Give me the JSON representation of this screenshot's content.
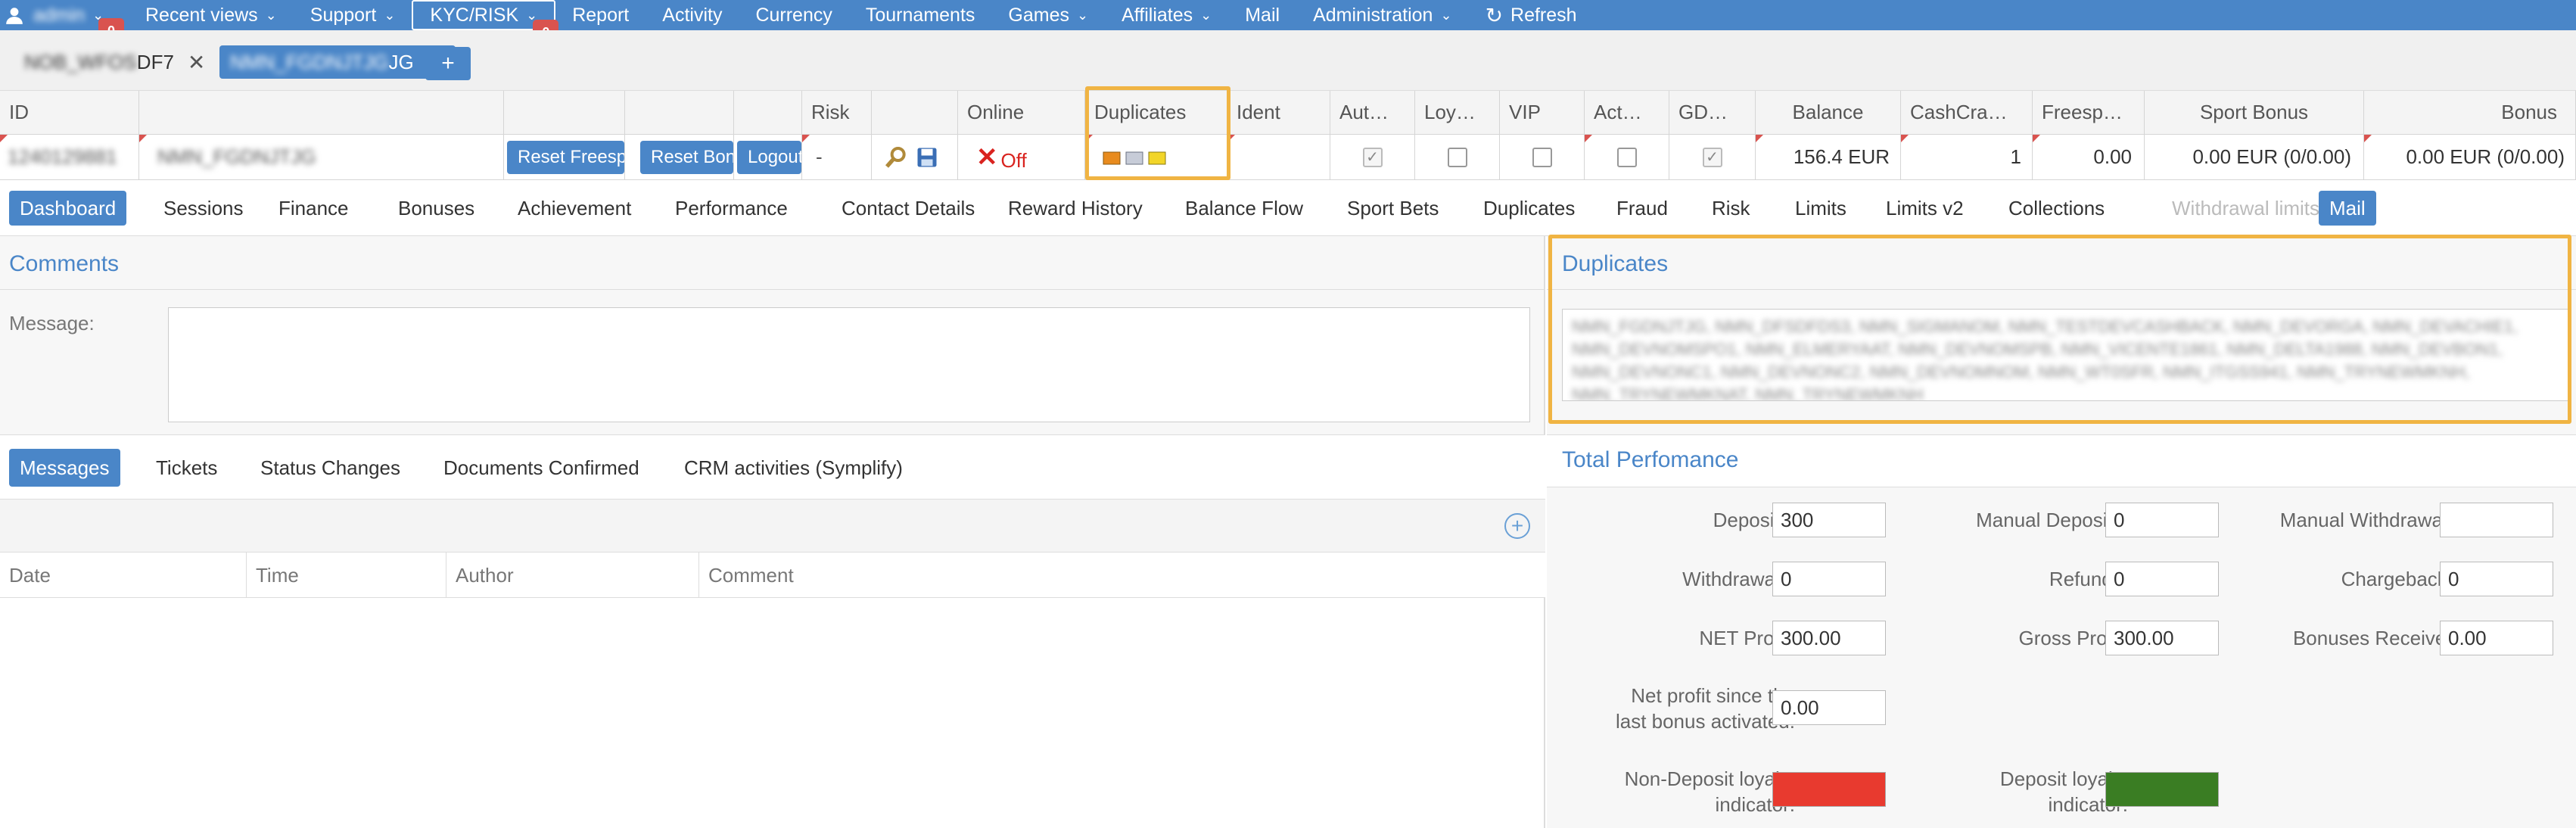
{
  "topnav": {
    "user": "admin",
    "user_badge": "0",
    "items": [
      {
        "label": "Recent views",
        "dropdown": true
      },
      {
        "label": "Support",
        "dropdown": true
      },
      {
        "label": "KYC/RISK",
        "dropdown": true,
        "badge": "0"
      },
      {
        "label": "Report",
        "dropdown": false
      },
      {
        "label": "Activity",
        "dropdown": false
      },
      {
        "label": "Currency",
        "dropdown": false
      },
      {
        "label": "Tournaments",
        "dropdown": false
      },
      {
        "label": "Games",
        "dropdown": true
      },
      {
        "label": "Affiliates",
        "dropdown": true
      },
      {
        "label": "Mail",
        "dropdown": false
      },
      {
        "label": "Administration",
        "dropdown": true
      }
    ],
    "refresh_label": "Refresh"
  },
  "player_tabs": [
    {
      "label_hidden": "NOB_WFOS",
      "label_visible": "DF7"
    },
    {
      "label_hidden": "NMN_FGDNJTJG",
      "label_visible": "JG"
    }
  ],
  "grid": {
    "headers": {
      "id": "ID",
      "risk": "Risk",
      "online": "Online",
      "duplicates": "Duplicates",
      "ident": "Ident",
      "aut": "Aut…",
      "loy": "Loy…",
      "vip": "VIP",
      "act": "Act…",
      "gd": "GD…",
      "balance": "Balance",
      "cashcra": "CashCra…",
      "freesp": "Freesp…",
      "sport_bonus": "Sport Bonus",
      "bonus": "Bonus"
    },
    "row": {
      "id": "1240129881",
      "login": "NMN_FGDNJTJG",
      "reset_freespins": "Reset Freespins",
      "reset_bonus": "Reset Bonus",
      "logout": "Logout",
      "risk": "-",
      "online": "Off",
      "balance": "156.4 EUR",
      "cashcra": "1",
      "freesp": "0.00",
      "sport_bonus": "0.00 EUR (0/0.00)",
      "bonus": "0.00 EUR (0/0.00)"
    }
  },
  "main_tabs": [
    "Dashboard",
    "Sessions",
    "Finance",
    "Bonuses",
    "Achievement",
    "Performance",
    "Contact Details",
    "Reward History",
    "Balance Flow",
    "Sport Bets",
    "Duplicates",
    "Fraud",
    "Risk",
    "Limits",
    "Limits v2",
    "Collections",
    "Withdrawal limits",
    "Mail"
  ],
  "comments": {
    "title": "Comments",
    "message_label": "Message:"
  },
  "sub_tabs": [
    "Messages",
    "Tickets",
    "Status Changes",
    "Documents Confirmed",
    "CRM activities (Symplify)"
  ],
  "table_headers": [
    "Date",
    "Time",
    "Author",
    "Comment"
  ],
  "duplicates_panel": {
    "title": "Duplicates",
    "content": "NMN_FGDNJTJG, NMN_DFSDFDS3, NMN_SIGMANOM, NMN_TESTDEVCASHBACK, NMN_DEVORGA, NMN_DEVACHIE1, NMN_DEVNOMSPO1, NMN_ELMERYAAT, NMN_DEVNOMSPB, NMN_VICENTE1861, NMN_DELTA1988, NMN_DEVBON1, NMN_DEVNONC1, NMN_DEVNONC2, NMN_DEVNOMNOM, NMN_WT0SFR, NMN_ITGSS941, NMN_TRYNEWMKNH, NMN_TRYNEWMKNAT, NMN_TRYNEWMKNH"
  },
  "performance": {
    "title": "Total Perfomance",
    "fields": {
      "deposits": {
        "label": "Deposits:",
        "value": "300"
      },
      "manual_deposits": {
        "label": "Manual Deposits:",
        "value": "0"
      },
      "manual_withdrawals": {
        "label": "Manual Withdrawals:",
        "value": ""
      },
      "withdrawals": {
        "label": "Withdrawals:",
        "value": "0"
      },
      "refunds": {
        "label": "Refunds:",
        "value": "0"
      },
      "chargebacks": {
        "label": "Chargebacks:",
        "value": "0"
      },
      "net_profit": {
        "label": "NET Profit:",
        "value": "300.00"
      },
      "gross_profit": {
        "label": "Gross Profit:",
        "value": "300.00"
      },
      "bonuses_received": {
        "label": "Bonuses Received:",
        "value": "0.00"
      },
      "net_profit_since": {
        "label_line1": "Net profit since the",
        "label_line2": "last bonus activated:",
        "value": "0.00"
      },
      "non_deposit_loyalty": {
        "label_line1": "Non-Deposit loyalty",
        "label_line2": "indicator:",
        "color": "#e83a2f"
      },
      "deposit_loyalty": {
        "label_line1": "Deposit loyalty",
        "label_line2": "indicator:",
        "color": "#3a7d23"
      }
    }
  },
  "colors": {
    "primary": "#4a86c8",
    "highlight": "#f0b443",
    "badge": "#d9534f",
    "offline": "#d9231f"
  }
}
